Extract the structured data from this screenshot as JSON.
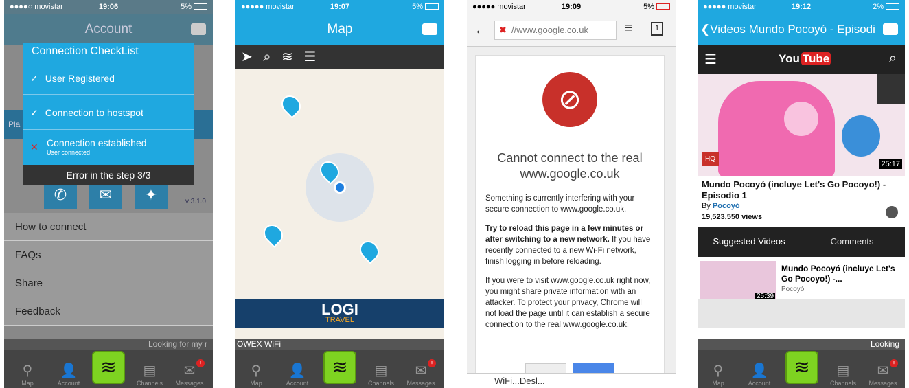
{
  "p1": {
    "carrier": "●●●●○ movistar",
    "time": "19:06",
    "battery": "5%",
    "title": "Account",
    "check_title": "Connection CheckList",
    "items": [
      {
        "mark": "✓",
        "label": "User Registered",
        "sub": ""
      },
      {
        "mark": "✓",
        "label": "Connection to hostspot",
        "sub": ""
      },
      {
        "mark": "✕",
        "label": "Connection established",
        "sub": "User connected"
      }
    ],
    "error": "Error in the step  3/3",
    "version": "v 3.1.0",
    "menu": [
      "How to connect",
      "FAQs",
      "Share",
      "Feedback"
    ],
    "strip": "Looking for my r"
  },
  "p2": {
    "carrier": "●●●●● movistar",
    "time": "19:07",
    "battery": "5%",
    "title": "Map",
    "logo": "LOGI",
    "logo_sub": "TRAVEL",
    "wifi_label": "OWEX WiFi"
  },
  "p3": {
    "carrier": "●●●●● movistar",
    "time": "19:09",
    "battery": "5%",
    "url": "//www.google.co.uk",
    "heading": "Cannot connect to the real www.google.co.uk",
    "p1": "Something is currently interfering with your secure connection to www.google.co.uk.",
    "p2_bold": "Try to reload this page in a few minutes or after switching to a new network.",
    "p2_rest": " If you have recently connected to a new Wi-Fi network, finish logging in before reloading.",
    "p3": "If you were to visit www.google.co.uk right now, you might share private information with an attacker. To protect your privacy, Chrome will not load the page until it can establish a secure connection to the real www.google.co.uk.",
    "bottom": "WiFi...Desl..."
  },
  "p4": {
    "carrier": "●●●●● movistar",
    "time": "19:12",
    "battery": "2%",
    "title": "Videos Mundo Pocoyó - Episodi",
    "yt": "You",
    "yt2": "Tube",
    "hq": "HQ",
    "duration": "25:17",
    "video_title": "Mundo Pocoyó (incluye Let's Go Pocoyo!) - Episodio 1",
    "by": "By",
    "author": "Pocoyó",
    "views": "19,523,550 views",
    "tab1": "Suggested Videos",
    "tab2": "Comments",
    "sug_title": "Mundo Pocoyó (incluye Let's Go Pocoyo!) -...",
    "sug_author": "Pocoyó",
    "sug_dur": "25:39",
    "strip": "Looking"
  },
  "tabs": [
    "Map",
    "Account",
    "",
    "Channels",
    "Messages"
  ],
  "badge": "!"
}
